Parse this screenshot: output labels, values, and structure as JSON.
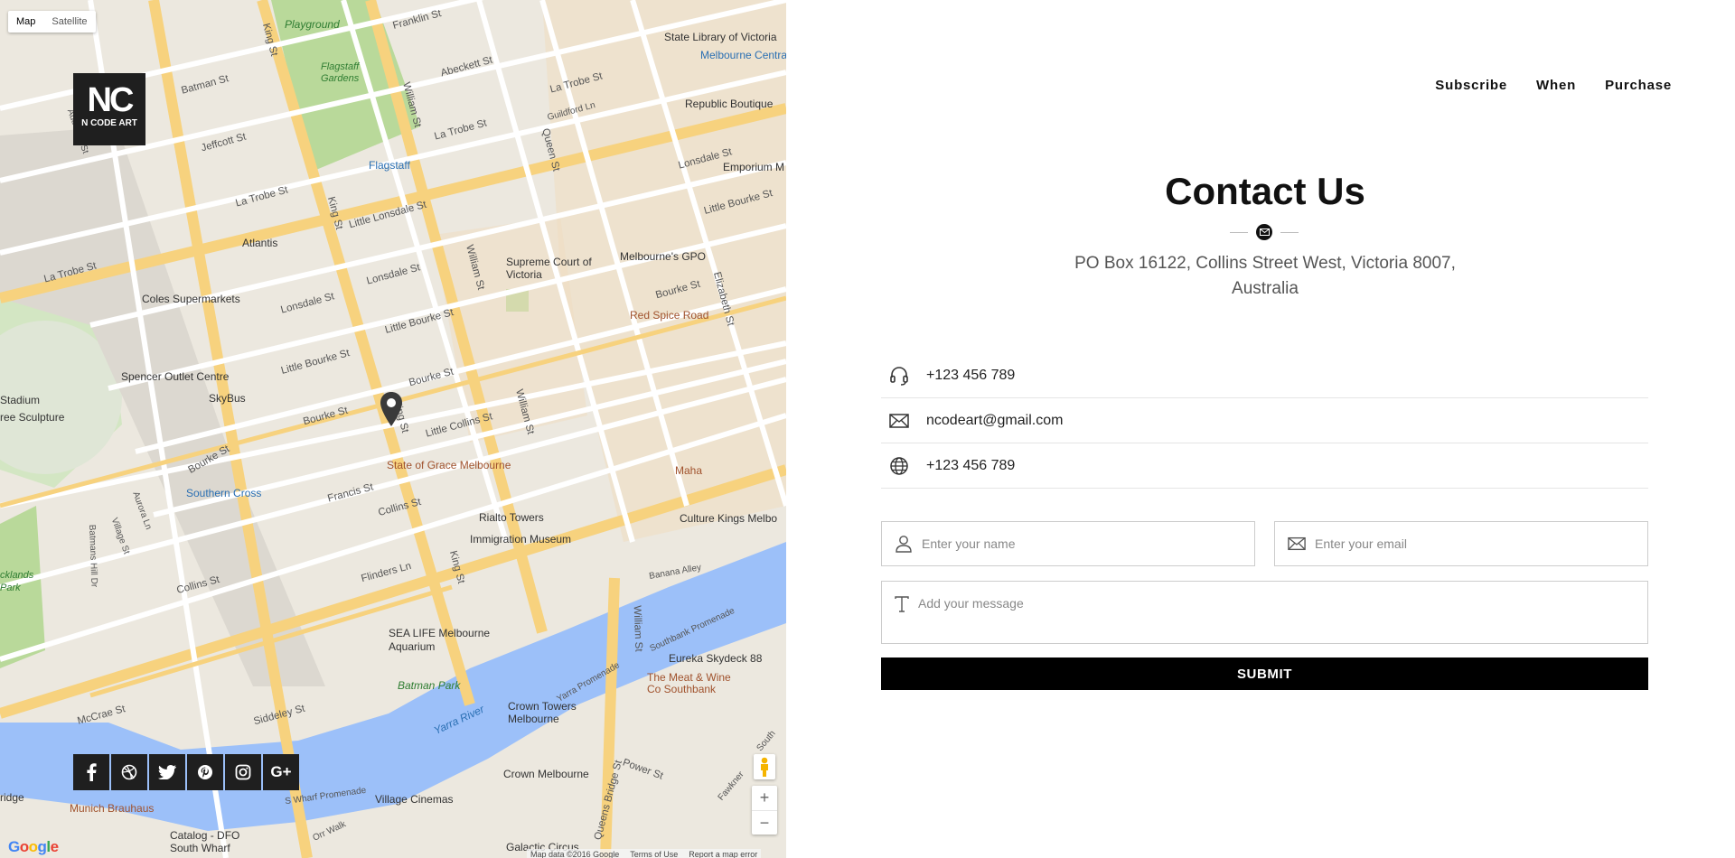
{
  "map": {
    "type_map": "Map",
    "type_satellite": "Satellite",
    "logo_mono": "NC",
    "logo_brand": "N CODE ART",
    "zoom_in": "+",
    "zoom_out": "−",
    "google": "Google",
    "attribution": {
      "data": "Map data ©2016 Google",
      "terms": "Terms of Use",
      "report": "Report a map error"
    },
    "labels": {
      "playground": "Playground",
      "flagstaff_gardens": "Flagstaff Gardens",
      "state_library": "State Library of Victoria",
      "melbourne_central": "Melbourne Central",
      "republic_boutique": "Republic Boutique",
      "emporium": "Emporium M",
      "flagstaff": "Flagstaff",
      "atlantis": "Atlantis",
      "supreme_court": "Supreme Court of Victoria",
      "melbourne_gpo": "Melbourne's GPO",
      "coles": "Coles Supermarkets",
      "red_spice": "Red Spice Road",
      "spencer_outlet": "Spencer Outlet Centre",
      "skybus": "SkyBus",
      "stadium": "Stadium",
      "tree_sculpture": "ree Sculpture",
      "state_of_grace": "State of Grace Melbourne",
      "maha": "Maha",
      "southern_cross": "Southern Cross",
      "rialto": "Rialto Towers",
      "culture_kings": "Culture Kings Melbo",
      "immigration": "Immigration Museum",
      "docklands": "cklands Park",
      "sea_life": "SEA LIFE Melbourne Aquarium",
      "eureka": "Eureka Skydeck 88",
      "meat_wine": "The Meat & Wine Co Southbank",
      "batman_park": "Batman Park",
      "crown_towers": "Crown Towers Melbourne",
      "crown_melbourne": "Crown Melbourne",
      "munich": "Munich Brauhaus",
      "village_cinemas": "Village Cinemas",
      "catalog": "Catalog - DFO South Wharf",
      "galactic": "Galactic Circus",
      "yarra_river": "Yarra River",
      "bridge": "ridge",
      "streets": {
        "king_st": "King St",
        "william_st": "William St",
        "batman_st": "Batman St",
        "jeffcott_st": "Jeffcott St",
        "la_trobe_st": "La Trobe St",
        "little_lonsdale": "Little Lonsdale St",
        "lonsdale_st": "Lonsdale St",
        "little_bourke": "Little Bourke St",
        "bourke_st": "Bourke St",
        "little_collins": "Little Collins St",
        "collins_st": "Collins St",
        "flinders_ln": "Flinders Ln",
        "francis_st": "Francis St",
        "mccrae_st": "McCrae St",
        "siddeley_st": "Siddeley St",
        "queens_bridge": "Queens Bridge St",
        "queen_st": "Queen St",
        "elizabeth_st": "Elizabeth St",
        "franklin_st": "Franklin St",
        "abeckett_st": "Abeckett St",
        "guildford_ln": "Guildford Ln",
        "banana_alley": "Banana Alley",
        "southbank_promenade": "Southbank Promenade",
        "yarra_promenade": "Yarra Promenade",
        "s_wharf_promenade": "S Wharf Promenade",
        "power_st": "Power St",
        "aurora_ln": "Aurora Ln",
        "village_st": "Village St",
        "batmans_hill": "Batmans Hill Dr",
        "adderley_st": "Adderley St",
        "orr_walk": "Orr Walk",
        "fawkner": "Fawkner",
        "south": "South"
      }
    },
    "social": [
      "f",
      "dribbble",
      "twitter",
      "pinterest",
      "instagram",
      "G+"
    ]
  },
  "nav": {
    "subscribe": "Subscribe",
    "when": "When",
    "purchase": "Purchase"
  },
  "contact": {
    "title": "Contact Us",
    "address": "PO Box 16122, Collins Street West, Victoria 8007, Australia",
    "phone": "+123 456 789",
    "email": "ncodeart@gmail.com",
    "website": "+123 456 789"
  },
  "form": {
    "name_placeholder": "Enter your name",
    "email_placeholder": "Enter your email",
    "message_placeholder": "Add your message",
    "submit": "SUBMIT"
  }
}
